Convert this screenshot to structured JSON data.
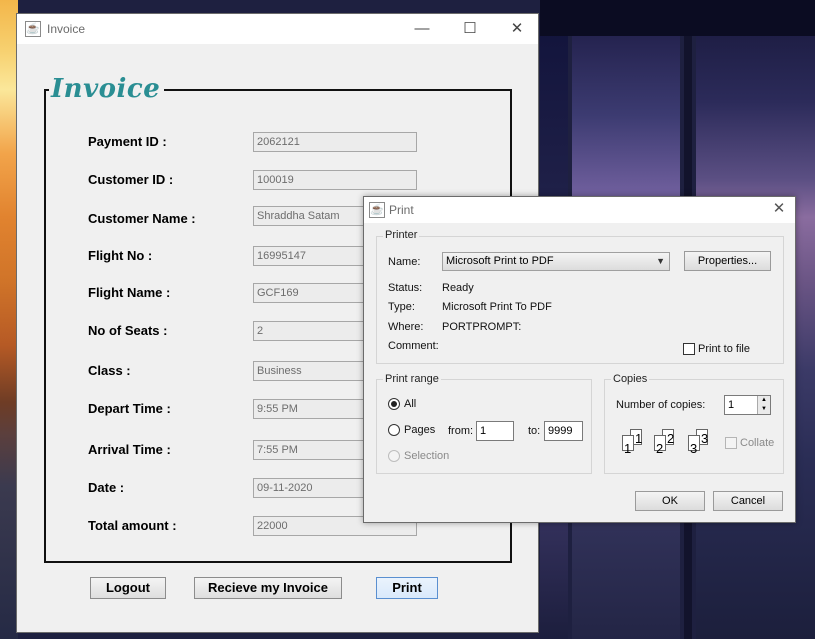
{
  "invoice_window": {
    "title": "Invoice",
    "heading": "Invoice",
    "fields": [
      {
        "label": "Payment ID :",
        "value": "2062121"
      },
      {
        "label": "Customer ID :",
        "value": "100019"
      },
      {
        "label": "Customer Name :",
        "value": "Shraddha Satam"
      },
      {
        "label": "Flight No :",
        "value": "16995147"
      },
      {
        "label": "Flight Name :",
        "value": "GCF169"
      },
      {
        "label": "No of Seats :",
        "value": "2"
      },
      {
        "label": "Class :",
        "value": "Business"
      },
      {
        "label": "Depart Time :",
        "value": "9:55 PM"
      },
      {
        "label": "Arrival Time :",
        "value": "7:55 PM"
      },
      {
        "label": "Date :",
        "value": "09-11-2020"
      },
      {
        "label": "Total amount :",
        "value": "22000"
      }
    ],
    "buttons": {
      "logout": "Logout",
      "receive": "Recieve my Invoice",
      "print": "Print"
    }
  },
  "print_dialog": {
    "title": "Print",
    "printer_group": "Printer",
    "name_label": "Name:",
    "name_value": "Microsoft Print to PDF",
    "properties_button": "Properties...",
    "status_label": "Status:",
    "status_value": "Ready",
    "type_label": "Type:",
    "type_value": "Microsoft Print To PDF",
    "where_label": "Where:",
    "where_value": "PORTPROMPT:",
    "comment_label": "Comment:",
    "print_to_file": "Print to file",
    "print_range_group": "Print range",
    "all_label": "All",
    "pages_label": "Pages",
    "from_label": "from:",
    "from_value": "1",
    "to_label": "to:",
    "to_value": "9999",
    "selection_label": "Selection",
    "copies_group": "Copies",
    "num_copies_label": "Number of copies:",
    "num_copies_value": "1",
    "collate_label": "Collate",
    "ok_button": "OK",
    "cancel_button": "Cancel"
  },
  "icons": [
    "java-cup-icon",
    "minimize-icon",
    "maximize-icon",
    "close-icon",
    "combo-arrow-icon",
    "spinner-up-icon",
    "spinner-down-icon",
    "collate-pages-icon"
  ]
}
